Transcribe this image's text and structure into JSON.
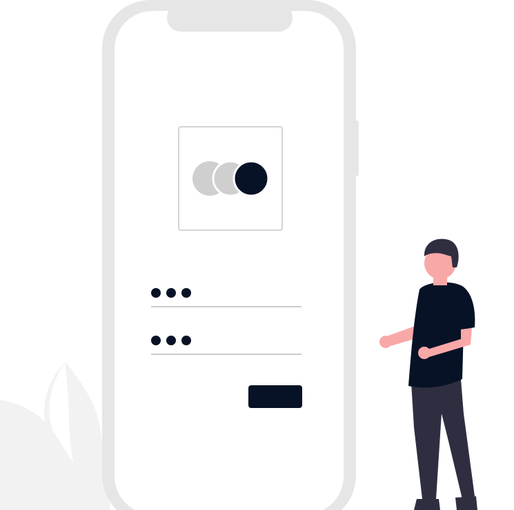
{
  "colors": {
    "phone_frame": "#e6e6e6",
    "phone_screen": "#ffffff",
    "logo_box_border": "#d4d4d4",
    "logo_circle_light": "#cfcfcf",
    "logo_circle_dark": "#081226",
    "dots": "#081226",
    "field_underline": "#cccccc",
    "button": "#081226",
    "leaf": "#f2f2f2",
    "person_shirt": "#081226",
    "person_skin": "#f9a8a8",
    "person_pants": "#2f2e41",
    "person_hair": "#2f2e41"
  },
  "login_form": {
    "password_field_count": 2,
    "masked_dot_count": 3
  },
  "icons": {
    "logo": "three-overlapping-circles-icon",
    "leaf": "leaf-icon",
    "person": "person-illustration"
  }
}
